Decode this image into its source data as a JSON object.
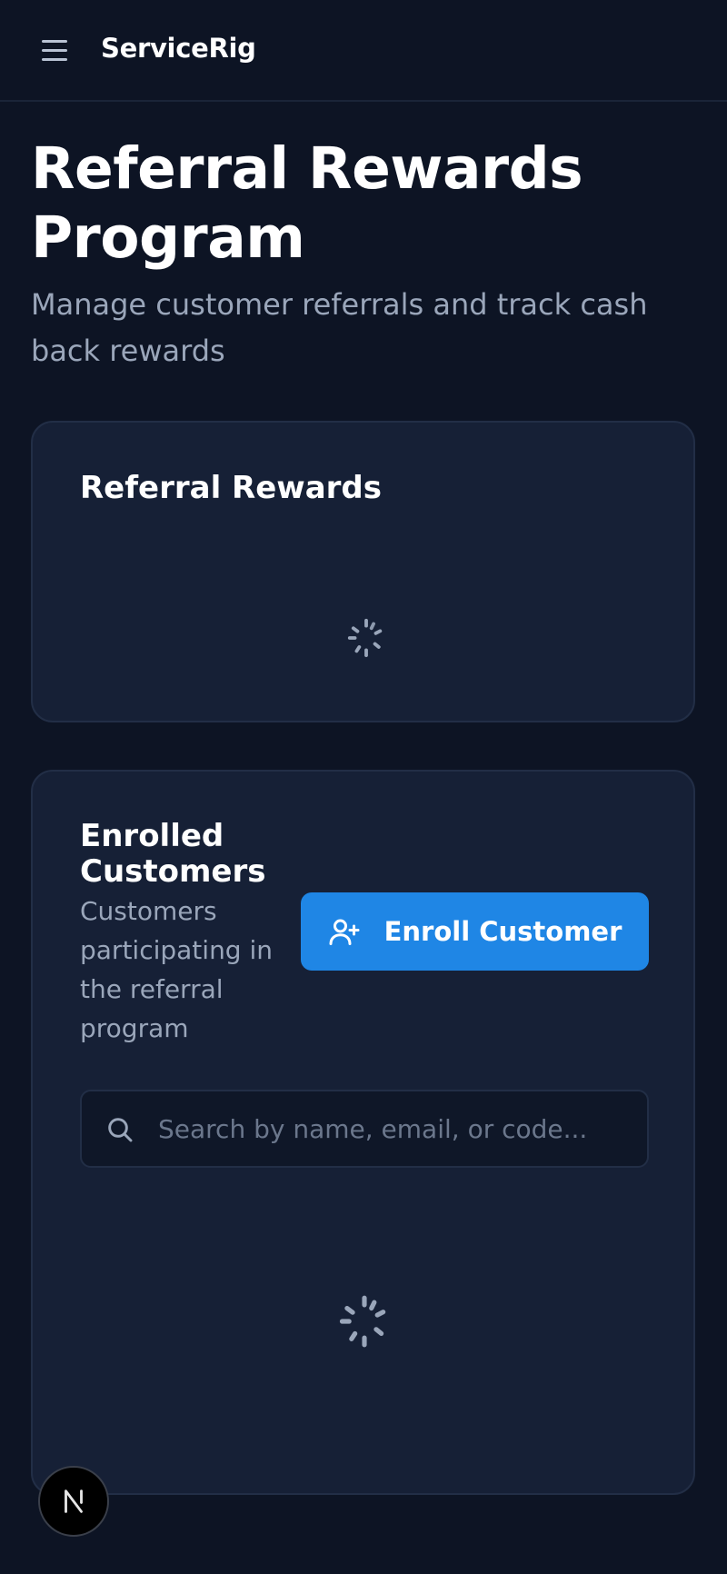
{
  "header": {
    "brand": "ServiceRig",
    "menu_icon": "hamburger-menu-icon"
  },
  "page": {
    "title": "Referral Rewards Program",
    "subtitle": "Manage customer referrals and track cash back rewards"
  },
  "rewards_card": {
    "title": "Referral Rewards",
    "loading_icon": "spinner-icon"
  },
  "enrolled_card": {
    "title": "Enrolled Customers",
    "description": "Customers participating in the referral program",
    "enroll_button_label": "Enroll Customer",
    "enroll_button_icon": "user-plus-icon",
    "search_placeholder": "Search by name, email, or code...",
    "search_icon": "search-icon",
    "loading_icon": "spinner-icon"
  },
  "floating_button": {
    "icon": "nextjs-logo-icon"
  },
  "colors": {
    "background": "#0d1424",
    "card": "#162036",
    "accent": "#1f86e5",
    "muted_text": "#9aa6ba"
  }
}
